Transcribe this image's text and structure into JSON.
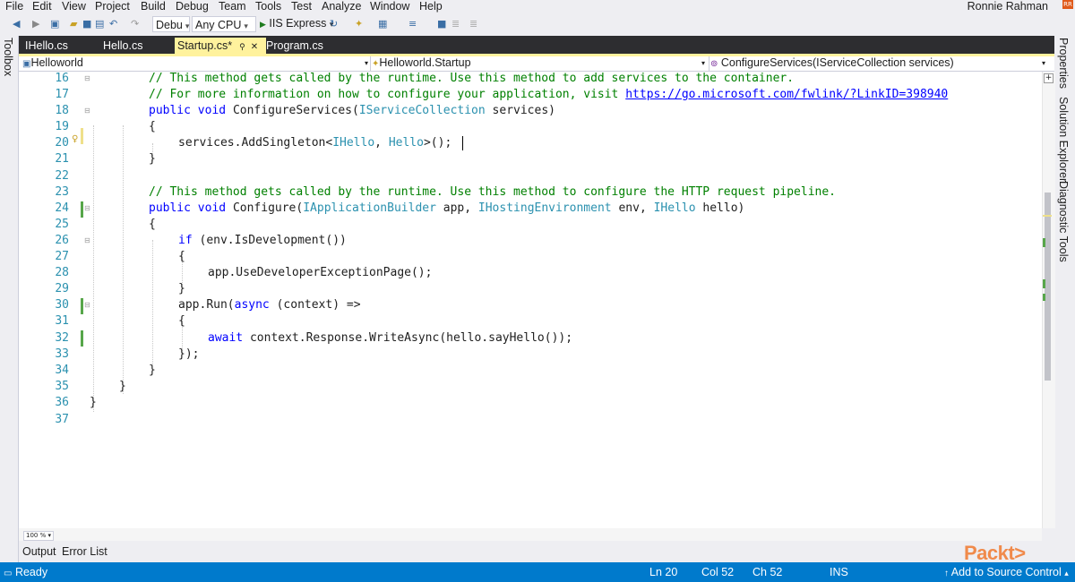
{
  "menu": [
    "File",
    "Edit",
    "View",
    "Project",
    "Build",
    "Debug",
    "Team",
    "Tools",
    "Test",
    "Analyze",
    "Window",
    "Help"
  ],
  "user": {
    "name": "Ronnie Rahman",
    "badge": "RR"
  },
  "toolbar": {
    "config": "Debu",
    "platform": "Any CPU",
    "run_target": "IIS Express"
  },
  "side_tabs": {
    "left": "Toolbox",
    "right": [
      "Properties",
      "Solution Explorer",
      "Diagnostic Tools"
    ]
  },
  "tabs": [
    {
      "label": "IHello.cs",
      "active": false
    },
    {
      "label": "Hello.cs",
      "active": false
    },
    {
      "label": "Startup.cs*",
      "active": true
    },
    {
      "label": "Program.cs",
      "active": false
    }
  ],
  "navbar": {
    "project": "Helloworld",
    "type": "Helloworld.Startup",
    "member": "ConfigureServices(IServiceCollection services)"
  },
  "code_lines": [
    {
      "n": "16",
      "text": "// This method gets called by the runtime. Use this method to add services to the container."
    },
    {
      "n": "17",
      "text": "// For more information on how to configure your application, visit ",
      "link": "https://go.microsoft.com/fwlink/?LinkID=398940"
    },
    {
      "n": "18",
      "text": "public void ConfigureServices(IServiceCollection services)"
    },
    {
      "n": "19",
      "text": "{"
    },
    {
      "n": "20",
      "text": "services.AddSingleton<IHello, Hello>();"
    },
    {
      "n": "21",
      "text": "}"
    },
    {
      "n": "22",
      "text": ""
    },
    {
      "n": "23",
      "text": "// This method gets called by the runtime. Use this method to configure the HTTP request pipeline."
    },
    {
      "n": "24",
      "text": "public void Configure(IApplicationBuilder app, IHostingEnvironment env, IHello hello)"
    },
    {
      "n": "25",
      "text": "{"
    },
    {
      "n": "26",
      "text": "if (env.IsDevelopment())"
    },
    {
      "n": "27",
      "text": "{"
    },
    {
      "n": "28",
      "text": "app.UseDeveloperExceptionPage();"
    },
    {
      "n": "29",
      "text": "}"
    },
    {
      "n": "30",
      "text": "app.Run(async (context) =>"
    },
    {
      "n": "31",
      "text": "{"
    },
    {
      "n": "32",
      "text": "await context.Response.WriteAsync(hello.sayHello());"
    },
    {
      "n": "33",
      "text": "});"
    },
    {
      "n": "34",
      "text": "}"
    },
    {
      "n": "35",
      "text": "}"
    },
    {
      "n": "36",
      "text": "}"
    },
    {
      "n": "37",
      "text": ""
    }
  ],
  "zoom": "100 %",
  "bottom_tabs": [
    "Output",
    "Error List"
  ],
  "watermark": "Packt>",
  "status": {
    "state": "Ready",
    "ln": "Ln 20",
    "col": "Col 52",
    "ch": "Ch 52",
    "mode": "INS",
    "source_control": "Add to Source Control"
  },
  "colors": {
    "status_bar": "#007ACC",
    "active_tab": "#FFF29D",
    "comment": "#008000",
    "keyword": "#0000FF",
    "type": "#2B91AF"
  }
}
